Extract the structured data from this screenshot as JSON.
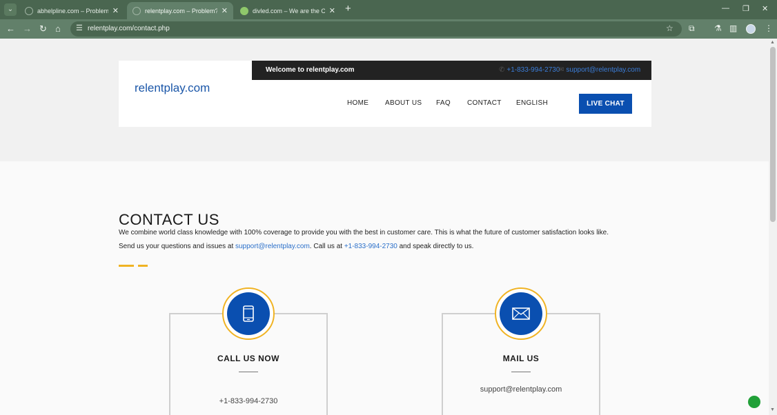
{
  "browser": {
    "tabs": [
      {
        "title": "abhelpline.com – Problem? We",
        "active": false
      },
      {
        "title": "relentplay.com – Problem? We",
        "active": true
      },
      {
        "title": "divled.com – We are the Ones",
        "active": false
      }
    ],
    "url": "relentplay.com/contact.php"
  },
  "site": {
    "logo": "relentplay.com",
    "welcome": "Welcome to relentplay.com",
    "phone": "+1-833-994-2730",
    "email": "support@relentplay.com",
    "nav": [
      "HOME",
      "ABOUT US",
      "FAQ",
      "CONTACT",
      "ENGLISH"
    ],
    "cta": "LIVE CHAT"
  },
  "contact": {
    "title": "CONTACT US",
    "line1": "We combine world class knowledge with 100% coverage to provide you with the best in customer care. This is what the future of customer satisfaction looks like.",
    "line2_a": "Send us your questions and issues at ",
    "line2_email": "support@relentplay.com",
    "line2_b": ". Call us at ",
    "line2_phone": "+1-833-994-2730",
    "line2_c": " and speak directly to us."
  },
  "cards": {
    "call": {
      "title": "CALL US NOW",
      "value": "+1-833-994-2730"
    },
    "mail": {
      "title": "MAIL US",
      "value": "support@relentplay.com"
    }
  },
  "colors": {
    "brand_blue": "#0a4fb0",
    "accent_gold": "#f0b323",
    "chrome_green": "#62806a"
  }
}
